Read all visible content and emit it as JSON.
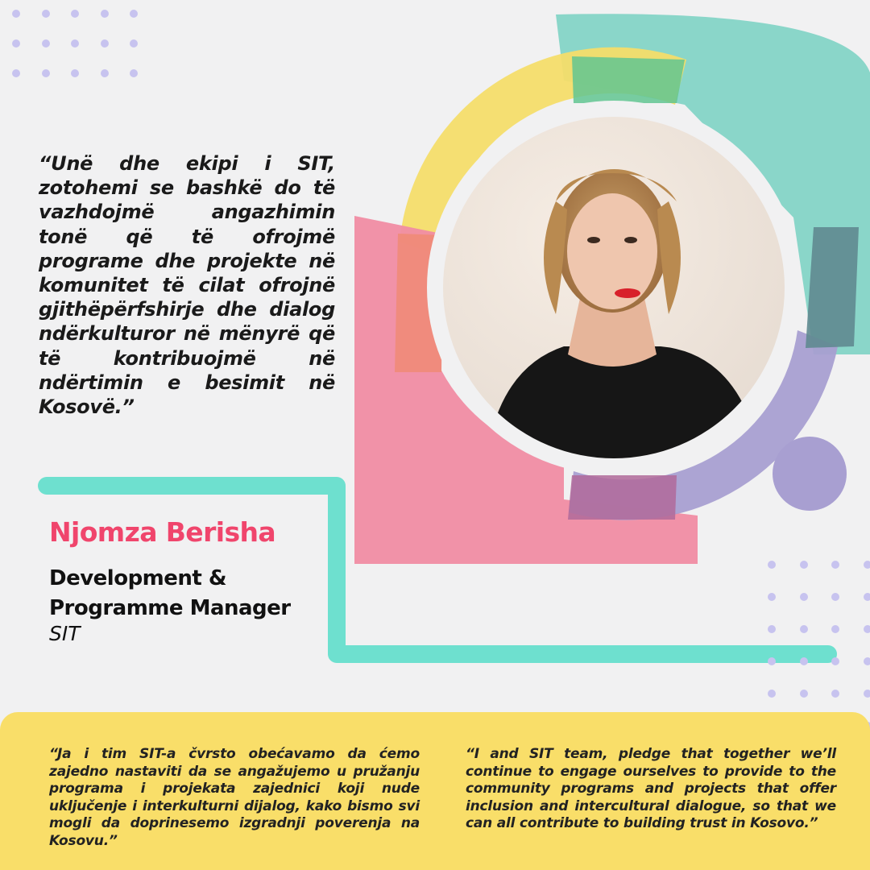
{
  "quote_albanian": "“Unë dhe ekipi i SIT, zotohemi se bashkë do të vazhdojmë angazhimin tonë që të ofrojmë programe dhe projekte në komunitet të cilat ofrojnë gjithëpërfshirje dhe dialog ndërkulturor në mënyrë që të kontribuojmë në ndërtimin e besimit në Kosovë.”",
  "person": {
    "name": "Njomza Berisha",
    "title_line1": "Development &",
    "title_line2": "Programme Manager",
    "organization": "SIT"
  },
  "quote_serbian": "“Ja i tim SIT-a čvrsto obećavamo da ćemo zajedno nastaviti da se angažujemo u pružanju programa i projekata zajednici koji nude uključenje i interkulturni dijalog, kako bismo svi mogli da doprinesemo izgradnji poverenja na Kosovu.”",
  "quote_english": "“I and SIT team, pledge that together we’ll continue to engage ourselves to provide to the community programs and projects that offer inclusion and intercultural dialogue, so that we can all contribute to building trust in Kosovo.”",
  "colors": {
    "background": "#f1f1f2",
    "name_pink": "#f0456c",
    "teal_line": "#6ee0cf",
    "yellow": "#f9de69",
    "pink_arc": "#f08ca3",
    "teal_arc": "#7ed3c4",
    "purple_arc": "#a89fd1",
    "dots": "#c7c3ef"
  },
  "icons": {
    "dots_top_left": "dot-grid-pattern",
    "dots_bottom_right": "dot-grid-pattern"
  }
}
